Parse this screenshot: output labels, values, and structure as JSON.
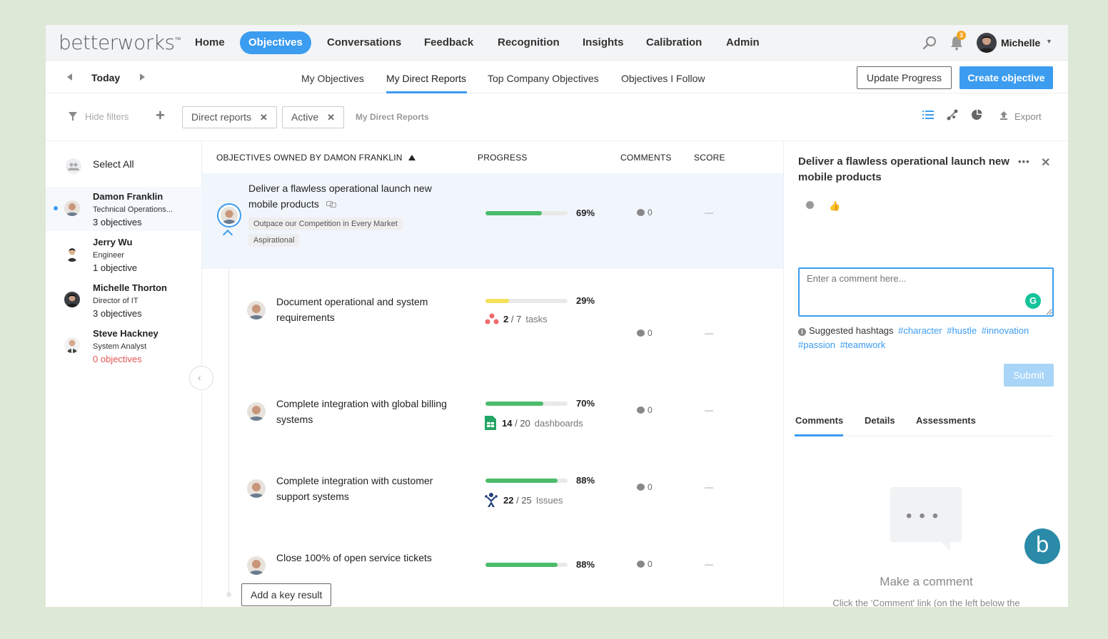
{
  "brand": {
    "logo": "betterworks",
    "logo_mark": "™"
  },
  "topnav": {
    "items": [
      "Home",
      "Objectives",
      "Conversations",
      "Feedback",
      "Recognition",
      "Insights",
      "Calibration",
      "Admin"
    ],
    "active": "Objectives",
    "notification_count": "3",
    "user_name": "Michelle"
  },
  "subnav": {
    "period": "Today",
    "tabs": [
      "My Objectives",
      "My Direct Reports",
      "Top Company Objectives",
      "Objectives I Follow"
    ],
    "active_tab": "My Direct Reports",
    "update_button": "Update Progress",
    "create_button": "Create objective"
  },
  "filters": {
    "hide_label": "Hide filters",
    "chips": [
      "Direct reports",
      "Active"
    ],
    "current": "My Direct Reports",
    "export_label": "Export"
  },
  "people": {
    "select_all": "Select All",
    "list": [
      {
        "name": "Damon Franklin",
        "role": "Technical Operations...",
        "objectives": "3 objectives",
        "selected": true
      },
      {
        "name": "Jerry Wu",
        "role": "Engineer",
        "objectives": "1 objective",
        "selected": false
      },
      {
        "name": "Michelle Thorton",
        "role": "Director of IT",
        "objectives": "3 objectives",
        "selected": false
      },
      {
        "name": "Steve Hackney",
        "role": "System Analyst",
        "objectives": "0 objectives",
        "selected": false
      }
    ]
  },
  "table": {
    "headers": {
      "owner": "OBJECTIVES OWNED BY DAMON FRANKLIN",
      "progress": "PROGRESS",
      "comments": "COMMENTS",
      "score": "SCORE"
    },
    "parent": {
      "title_line1": "Deliver a flawless operational launch new",
      "title_line2": "mobile products",
      "tags": [
        "Outpace our Competition in Every Market",
        "Aspirational"
      ],
      "progress_pct": 69,
      "progress_label": "69%",
      "progress_color": "#4cbb6b",
      "comments": "0",
      "score": "—"
    },
    "key_results": [
      {
        "title_line1": "Document operational and system",
        "title_line2": "requirements",
        "progress_pct": 29,
        "progress_label": "29%",
        "progress_color": "#f5e05a",
        "metric_done": "2",
        "metric_total": "/ 7",
        "metric_unit": "tasks",
        "metric_icon": "asana-icon",
        "comments": "0",
        "score": "—"
      },
      {
        "title_line1": "Complete integration with global billing",
        "title_line2": "systems",
        "progress_pct": 70,
        "progress_label": "70%",
        "progress_color": "#4cbb6b",
        "metric_done": "14",
        "metric_total": "/ 20",
        "metric_unit": "dashboards",
        "metric_icon": "sheets-icon",
        "comments": "0",
        "score": "—"
      },
      {
        "title_line1": "Complete integration with customer",
        "title_line2": "support systems",
        "progress_pct": 88,
        "progress_label": "88%",
        "progress_color": "#4cbb6b",
        "metric_done": "22",
        "metric_total": "/ 25",
        "metric_unit": "Issues",
        "metric_icon": "jira-icon",
        "comments": "0",
        "score": "—"
      },
      {
        "title_line1": "Close 100% of open service tickets",
        "title_line2": "",
        "progress_pct": 88,
        "progress_label": "88%",
        "progress_color": "#4cbb6b",
        "comments": "0",
        "score": "—"
      }
    ],
    "add_key_result": "Add a key result"
  },
  "panel": {
    "title": "Deliver a flawless operational launch new mobile products",
    "more": "•••",
    "comment_placeholder": "Enter a comment here...",
    "hashtags_label": "Suggested hashtags",
    "hashtags": [
      "#character",
      "#hustle",
      "#innovation",
      "#passion",
      "#teamwork"
    ],
    "submit": "Submit",
    "tabs": [
      "Comments",
      "Details",
      "Assessments"
    ],
    "empty_title": "Make a comment",
    "empty_hint": "Click the 'Comment' link (on the left below the"
  },
  "colors": {
    "accent": "#3b9cf0",
    "success": "#4cbb6b",
    "warning": "#f5e05a",
    "error": "#e25555"
  }
}
